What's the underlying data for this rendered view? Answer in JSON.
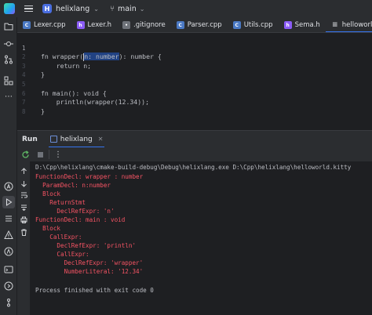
{
  "titlebar": {
    "project_badge": "H",
    "project_name": "helixlang",
    "branch": "main"
  },
  "tabs": [
    {
      "label": "Lexer.cpp",
      "type": "cpp"
    },
    {
      "label": "Lexer.h",
      "type": "h"
    },
    {
      "label": ".gitignore",
      "type": "git"
    },
    {
      "label": "Parser.cpp",
      "type": "cpp"
    },
    {
      "label": "Utils.cpp",
      "type": "cpp"
    },
    {
      "label": "Sema.h",
      "type": "h"
    },
    {
      "label": "helloworld.kitty",
      "type": "txt",
      "active": true
    }
  ],
  "editor": {
    "line_numbers": [
      "1",
      "2",
      "3",
      "4",
      "5",
      "6",
      "7",
      "8"
    ],
    "line1_before": "fn wrapper(",
    "line1_selected": "n: number",
    "line1_after": "): number {",
    "lines": [
      "",
      "    return n;",
      "}",
      "",
      "fn main(): void {",
      "    println(wrapper(12.34));",
      "}"
    ]
  },
  "run_panel": {
    "title": "Run",
    "tab_label": "helixlang",
    "command": "D:\\Cpp\\helixlang\\cmake-build-debug\\Debug\\helixlang.exe D:\\Cpp\\helixlang\\helloworld.kitty",
    "output": [
      "FunctionDecl: wrapper : number",
      "  ParamDecl: n:number",
      "  Block",
      "    ReturnStmt",
      "      DeclRefExpr: 'n'",
      "FunctionDecl: main : void",
      "  Block",
      "    CallExpr:",
      "      DeclRefExpr: 'println'",
      "      CallExpr:",
      "        DeclRefExpr: 'wrapper'",
      "        NumberLiteral: '12.34'"
    ],
    "exit_message": "Process finished with exit code 0"
  },
  "colors": {
    "background": "#1e1f22",
    "panel": "#2b2d30",
    "accent": "#3574f0",
    "error_text": "#f75464",
    "selection": "#214283"
  }
}
